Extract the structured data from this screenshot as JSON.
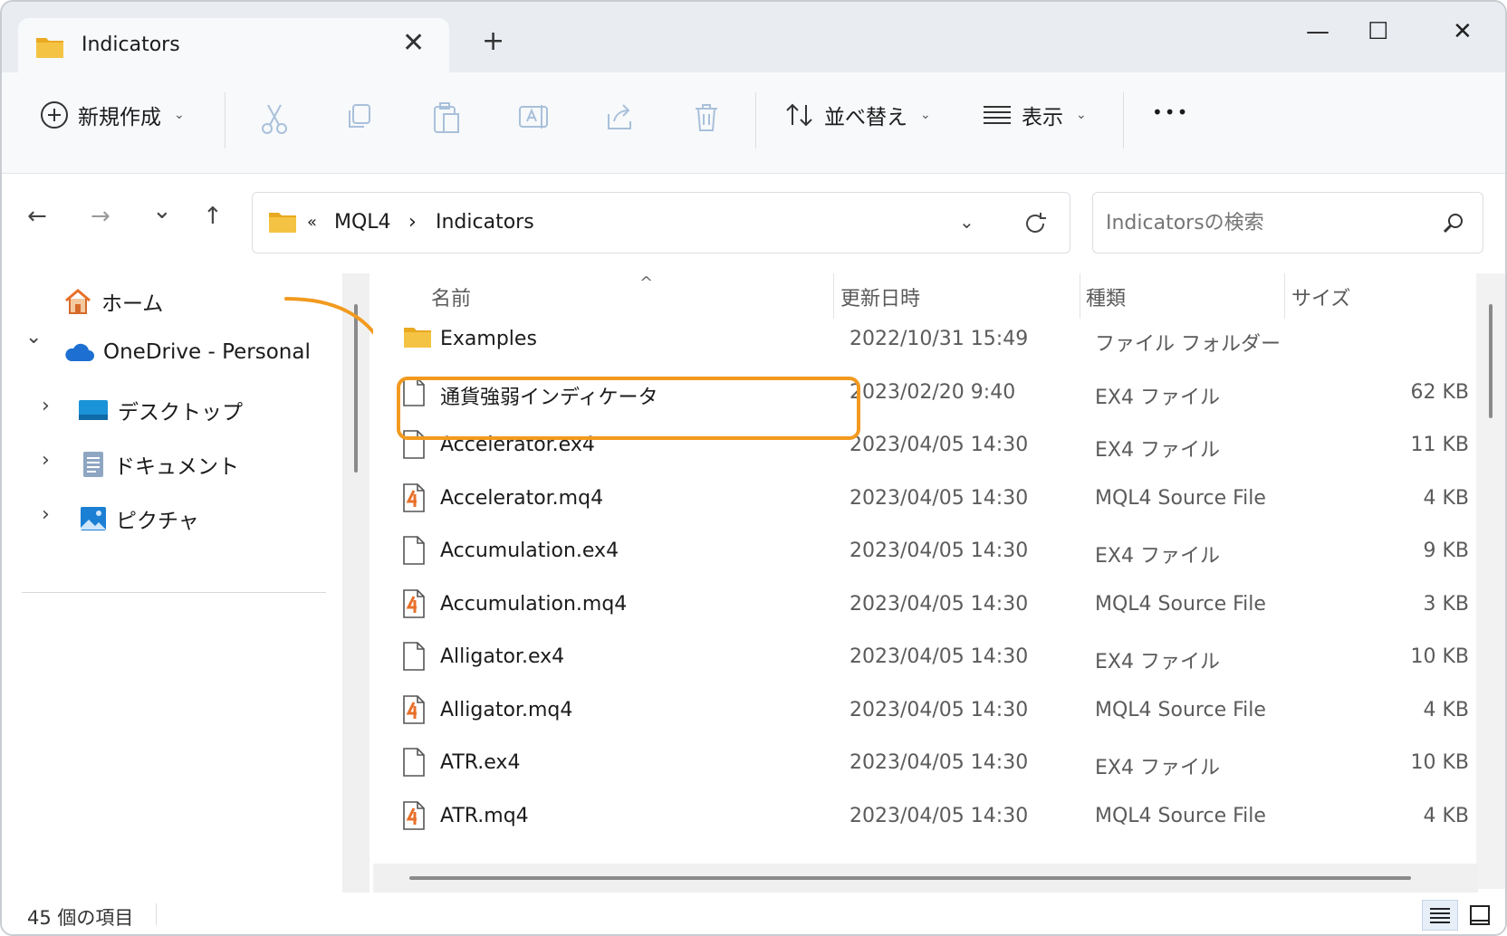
{
  "window": {
    "tab_title": "Indicators",
    "close_tab_glyph": "✕",
    "new_tab_glyph": "+",
    "minimize_glyph": "—",
    "maximize_glyph": "☐",
    "close_glyph": "✕"
  },
  "commandbar": {
    "new_label": "新規作成",
    "sort_label": "並べ替え",
    "view_label": "表示",
    "more_label": "•••",
    "icons": [
      "cut-icon",
      "copy-icon",
      "paste-icon",
      "rename-icon",
      "share-icon",
      "delete-icon"
    ]
  },
  "navigation": {
    "back": "←",
    "forward": "→",
    "recent": "⌄",
    "up": "↑"
  },
  "address": {
    "overflow": "«",
    "crumbs": [
      "MQL4",
      "Indicators"
    ],
    "separator": "›"
  },
  "search": {
    "placeholder": "Indicatorsの検索"
  },
  "navpane": {
    "items": [
      {
        "label": "ホーム"
      },
      {
        "label": "OneDrive - Personal"
      },
      {
        "label": "デスクトップ"
      },
      {
        "label": "ドキュメント"
      },
      {
        "label": "ピクチャ"
      }
    ]
  },
  "columns": {
    "name": "名前",
    "date": "更新日時",
    "type": "種類",
    "size": "サイズ"
  },
  "files": [
    {
      "name": "Examples",
      "date": "2022/10/31 15:49",
      "type": "ファイル フォルダー",
      "size": "",
      "icon": "folder-icon"
    },
    {
      "name": "通貨強弱インディケータ",
      "date": "2023/02/20 9:40",
      "type": "EX4 ファイル",
      "size": "62 KB",
      "icon": "file-icon"
    },
    {
      "name": "Accelerator.ex4",
      "date": "2023/04/05 14:30",
      "type": "EX4 ファイル",
      "size": "11 KB",
      "icon": "file-icon"
    },
    {
      "name": "Accelerator.mq4",
      "date": "2023/04/05 14:30",
      "type": "MQL4 Source File",
      "size": "4 KB",
      "icon": "mq4-file-icon"
    },
    {
      "name": "Accumulation.ex4",
      "date": "2023/04/05 14:30",
      "type": "EX4 ファイル",
      "size": "9 KB",
      "icon": "file-icon"
    },
    {
      "name": "Accumulation.mq4",
      "date": "2023/04/05 14:30",
      "type": "MQL4 Source File",
      "size": "3 KB",
      "icon": "mq4-file-icon"
    },
    {
      "name": "Alligator.ex4",
      "date": "2023/04/05 14:30",
      "type": "EX4 ファイル",
      "size": "10 KB",
      "icon": "file-icon"
    },
    {
      "name": "Alligator.mq4",
      "date": "2023/04/05 14:30",
      "type": "MQL4 Source File",
      "size": "4 KB",
      "icon": "mq4-file-icon"
    },
    {
      "name": "ATR.ex4",
      "date": "2023/04/05 14:30",
      "type": "EX4 ファイル",
      "size": "10 KB",
      "icon": "file-icon"
    },
    {
      "name": "ATR.mq4",
      "date": "2023/04/05 14:30",
      "type": "MQL4 Source File",
      "size": "4 KB",
      "icon": "mq4-file-icon"
    }
  ],
  "status": {
    "count": "45 個の項目"
  },
  "colors": {
    "accent": "#f29a1f",
    "folder": "#f5c343",
    "mq4": "#e8702a"
  }
}
